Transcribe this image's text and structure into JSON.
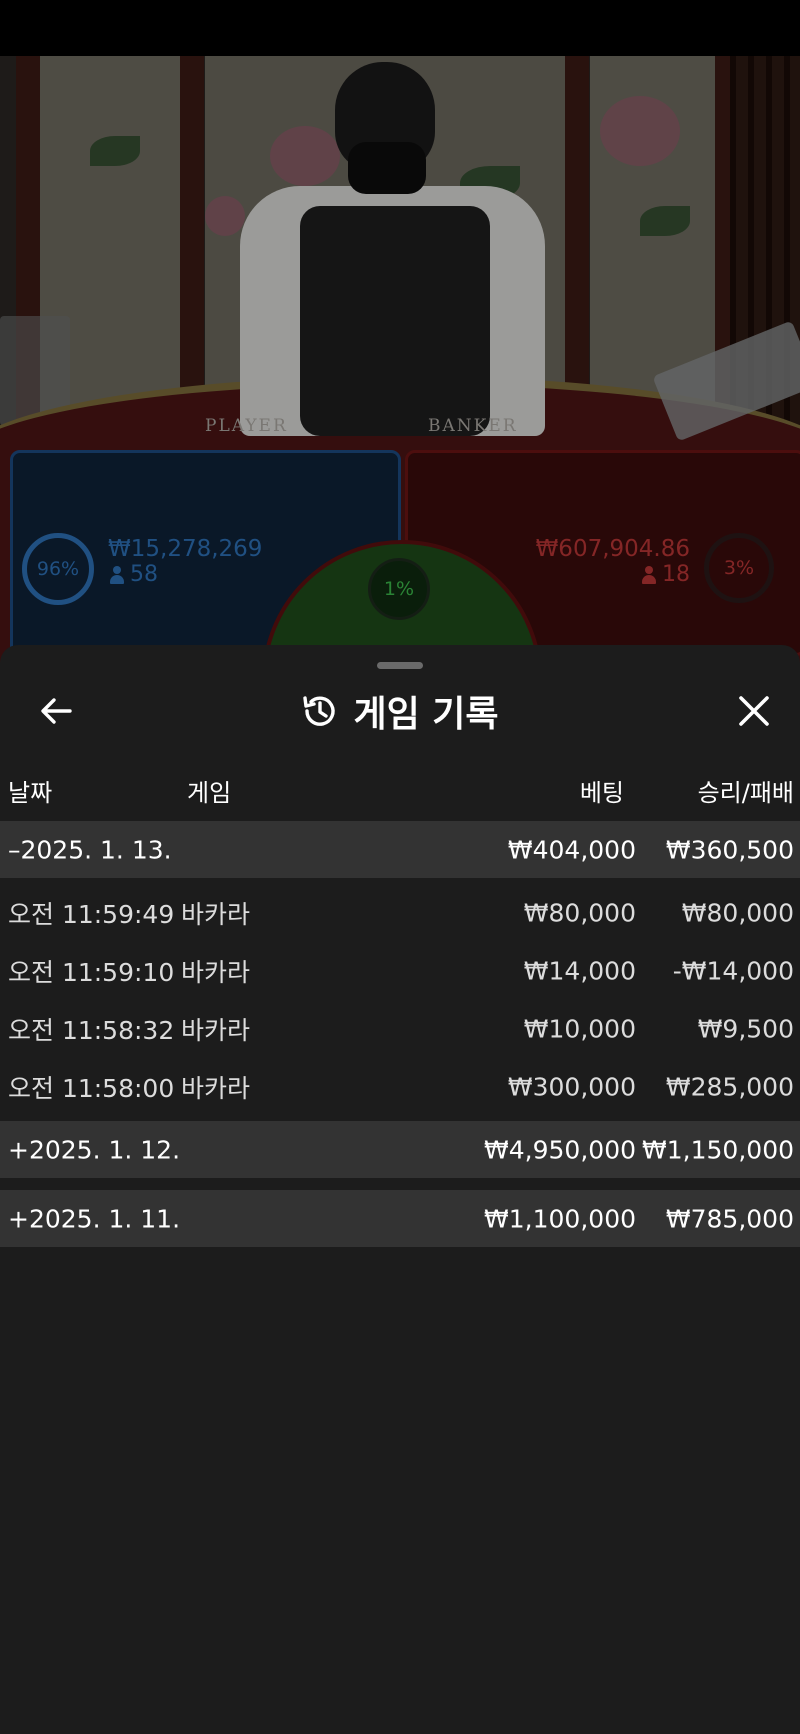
{
  "video": {
    "table_labels": {
      "player": "PLAYER",
      "banker": "BANKER"
    },
    "player": {
      "percent": "96%",
      "amount": "₩15,278,269",
      "count": "58"
    },
    "banker": {
      "percent": "3%",
      "amount": "₩607,904.86",
      "count": "18"
    },
    "tie": {
      "percent": "1%"
    }
  },
  "sheet": {
    "title": "게임 기록",
    "icons": {
      "back": "arrow-left-icon",
      "history": "history-icon",
      "close": "close-icon"
    },
    "columns": {
      "date": "날짜",
      "game": "게임",
      "bet": "베팅",
      "win_loss": "승리/패배"
    },
    "groups": [
      {
        "date": "–2025. 1. 13.",
        "bet": "₩404,000",
        "win_loss": "₩360,500",
        "expanded": true,
        "rows": [
          {
            "time": "오전 11:59:49",
            "game": "바카라",
            "bet": "₩80,000",
            "win_loss": "₩80,000"
          },
          {
            "time": "오전 11:59:10",
            "game": "바카라",
            "bet": "₩14,000",
            "win_loss": "-₩14,000"
          },
          {
            "time": "오전 11:58:32",
            "game": "바카라",
            "bet": "₩10,000",
            "win_loss": "₩9,500"
          },
          {
            "time": "오전 11:58:00",
            "game": "바카라",
            "bet": "₩300,000",
            "win_loss": "₩285,000"
          }
        ]
      },
      {
        "date": "+2025. 1. 12.",
        "bet": "₩4,950,000",
        "win_loss": "₩1,150,000",
        "expanded": false
      },
      {
        "date": "+2025. 1. 11.",
        "bet": "₩1,100,000",
        "win_loss": "₩785,000",
        "expanded": false
      }
    ]
  },
  "colors": {
    "player": "#2d6fb4",
    "banker": "#b83535",
    "tie": "#3bb64a",
    "sheet_bg": "#1c1c1c",
    "group_bg": "#333333"
  }
}
